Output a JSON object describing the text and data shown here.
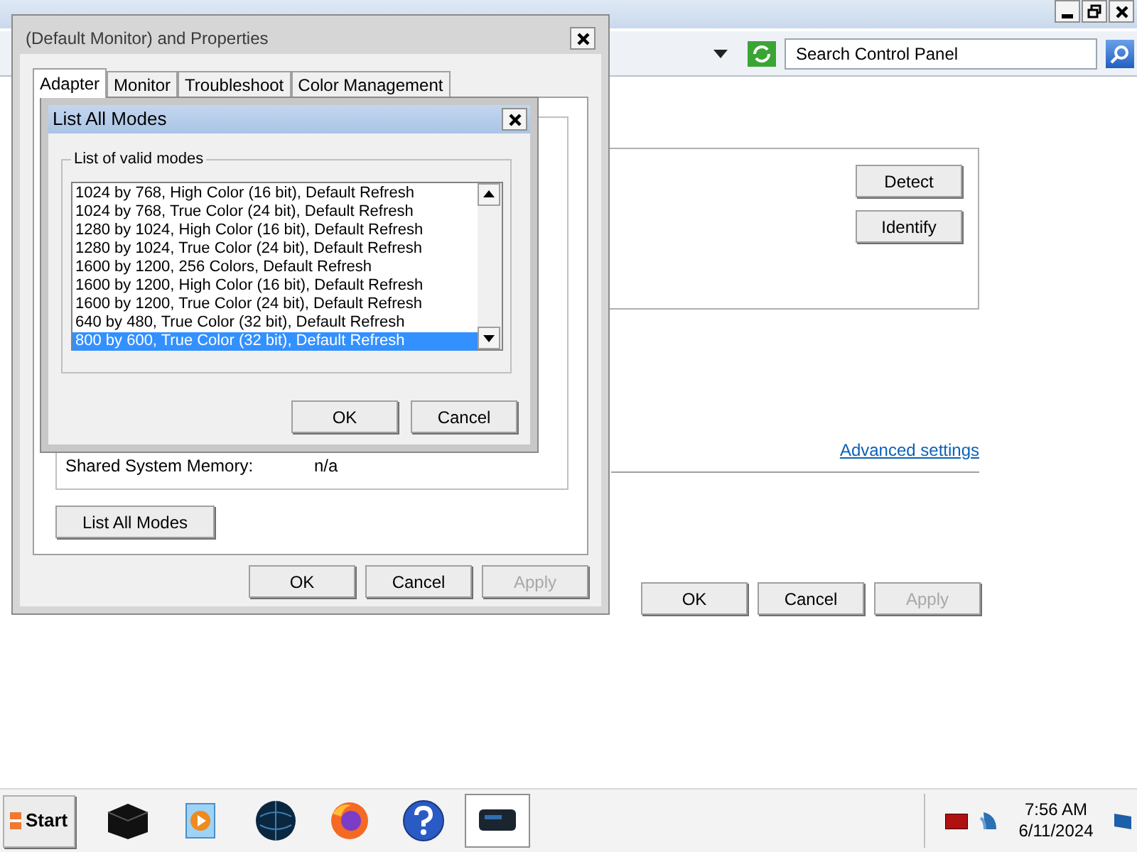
{
  "main_window": {
    "search": {
      "placeholder": "Search Control Panel"
    },
    "buttons": [
      {
        "label": "Detect",
        "disabled": false
      },
      {
        "label": "Identify",
        "disabled": false
      }
    ],
    "link": "Advanced settings",
    "footer_buttons": [
      {
        "label": "OK",
        "disabled": false
      },
      {
        "label": "Cancel",
        "disabled": false
      },
      {
        "label": "Apply",
        "disabled": true
      }
    ]
  },
  "properties_dialog": {
    "title": "(Default Monitor) and  Properties",
    "tabs": [
      {
        "label": "Adapter",
        "selected": true
      },
      {
        "label": "Monitor",
        "selected": false
      },
      {
        "label": "Troubleshoot",
        "selected": false
      },
      {
        "label": "Color Management",
        "selected": false
      }
    ],
    "info_rows": [
      {
        "label": "Shared System Memory:",
        "value": "n/a"
      }
    ],
    "list_button": "List All Modes",
    "footer_buttons": [
      {
        "label": "OK",
        "disabled": false
      },
      {
        "label": "Cancel",
        "disabled": false
      },
      {
        "label": "Apply",
        "disabled": true
      }
    ]
  },
  "modes_dialog": {
    "title": "List All Modes",
    "group_label": "List of valid modes",
    "modes": [
      {
        "label": "1024 by 768, High Color (16 bit), Default Refresh",
        "selected": false
      },
      {
        "label": "1024 by 768, True Color (24 bit), Default Refresh",
        "selected": false
      },
      {
        "label": "1280 by 1024, High Color (16 bit), Default Refresh",
        "selected": false
      },
      {
        "label": "1280 by 1024, True Color (24 bit), Default Refresh",
        "selected": false
      },
      {
        "label": "1600 by 1200, 256 Colors, Default Refresh",
        "selected": false
      },
      {
        "label": "1600 by 1200, High Color (16 bit), Default Refresh",
        "selected": false
      },
      {
        "label": "1600 by 1200, True Color (24 bit), Default Refresh",
        "selected": false
      },
      {
        "label": "640 by 480, True Color (32 bit), Default Refresh",
        "selected": false
      },
      {
        "label": "800 by 600, True Color (32 bit), Default Refresh",
        "selected": true
      }
    ],
    "buttons": [
      {
        "label": "OK",
        "disabled": false
      },
      {
        "label": "Cancel",
        "disabled": false
      }
    ]
  },
  "taskbar": {
    "start": "Start",
    "apps": [
      {
        "kind": "box",
        "selected": false
      },
      {
        "kind": "media",
        "selected": false
      },
      {
        "kind": "globe",
        "selected": false
      },
      {
        "kind": "fox",
        "selected": false
      },
      {
        "kind": "help",
        "selected": false
      },
      {
        "kind": "monitor",
        "selected": true
      }
    ],
    "time": "7:56 AM",
    "date": "6/11/2024"
  }
}
